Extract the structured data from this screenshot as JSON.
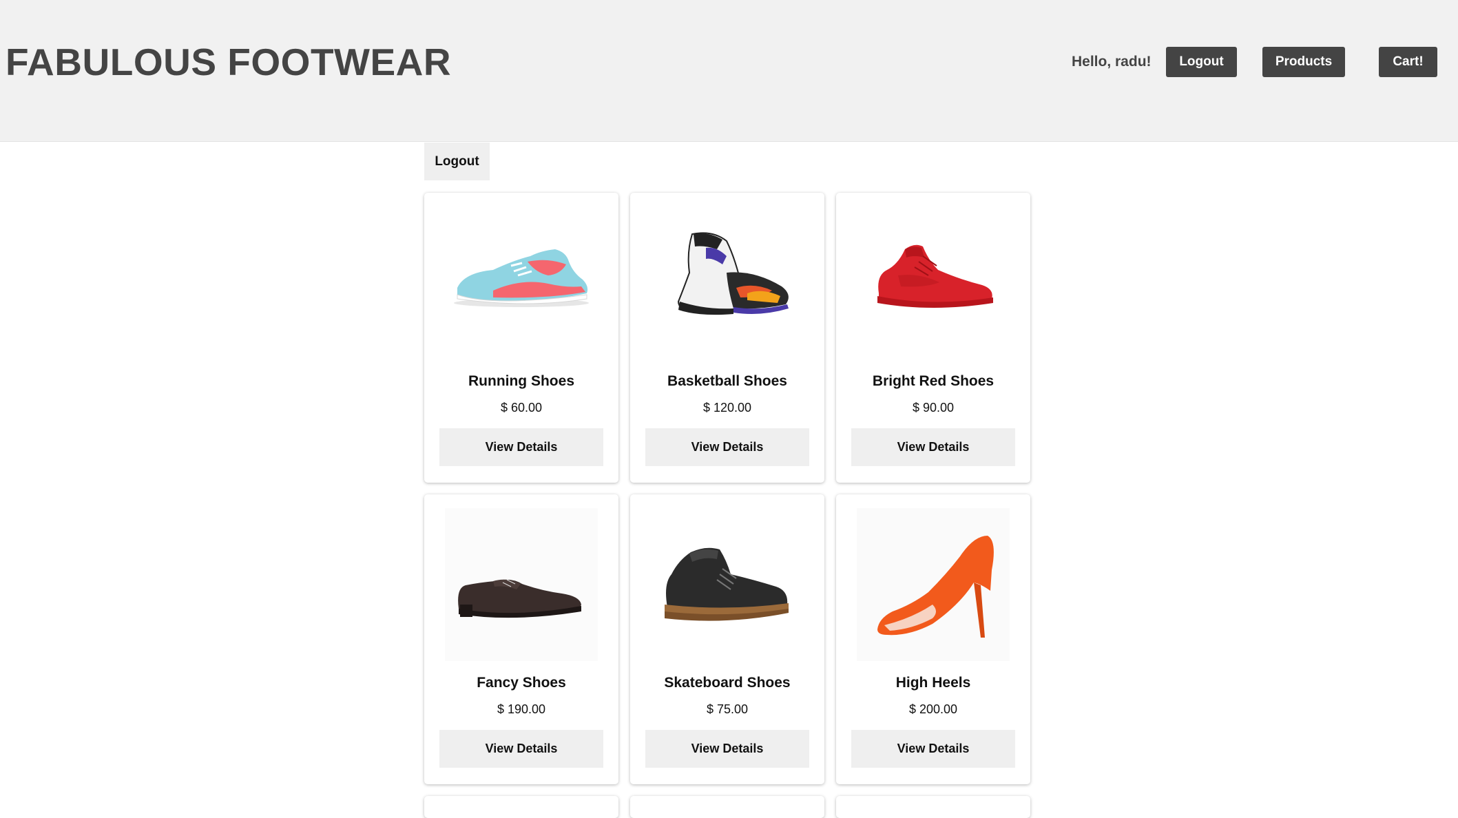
{
  "header": {
    "brand": "FABULOUS FOOTWEAR",
    "greeting": "Hello, radu!",
    "logout_label": "Logout",
    "products_label": "Products",
    "cart_label": "Cart!"
  },
  "subnav": {
    "logout_label": "Logout"
  },
  "products": [
    {
      "name": "Running Shoes",
      "price": "$ 60.00",
      "button": "View Details",
      "icon": "running-shoe-icon"
    },
    {
      "name": "Basketball Shoes",
      "price": "$ 120.00",
      "button": "View Details",
      "icon": "basketball-shoe-icon"
    },
    {
      "name": "Bright Red Shoes",
      "price": "$ 90.00",
      "button": "View Details",
      "icon": "red-sneaker-icon"
    },
    {
      "name": "Fancy Shoes",
      "price": "$ 190.00",
      "button": "View Details",
      "icon": "oxford-shoe-icon"
    },
    {
      "name": "Skateboard Shoes",
      "price": "$ 75.00",
      "button": "View Details",
      "icon": "skate-shoe-icon"
    },
    {
      "name": "High Heels",
      "price": "$ 200.00",
      "button": "View Details",
      "icon": "high-heel-icon"
    }
  ],
  "colors": {
    "header_bg": "#f1f1f1",
    "button_dark": "#444444",
    "button_light": "#efefef"
  }
}
